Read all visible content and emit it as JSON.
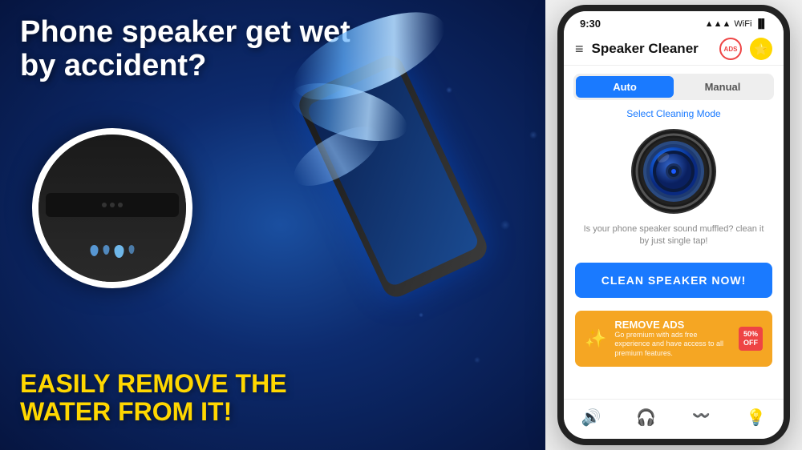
{
  "left": {
    "headline": "Phone speaker get wet by accident?",
    "subheadline": "EASILY REMOVE THE WATER FROM IT!"
  },
  "app": {
    "status_time": "9:30",
    "title": "Speaker Cleaner",
    "menu_icon": "≡",
    "ads_label": "ADS",
    "tabs": {
      "auto": "Auto",
      "manual": "Manual"
    },
    "select_mode": "Select Cleaning Mode",
    "description": "Is your phone speaker sound muffled? clean it by just single tap!",
    "clean_button": "CLEAN SPEAKER NOW!",
    "remove_ads": {
      "title": "REMOVE ADS",
      "description": "Go premium with ads free experience and have access to all premium features.",
      "off_label": "50%\nOFF"
    },
    "nav": {
      "speaker": "🔊",
      "headphone": "🎧",
      "vibration": "📳",
      "brightness": "💡"
    }
  }
}
